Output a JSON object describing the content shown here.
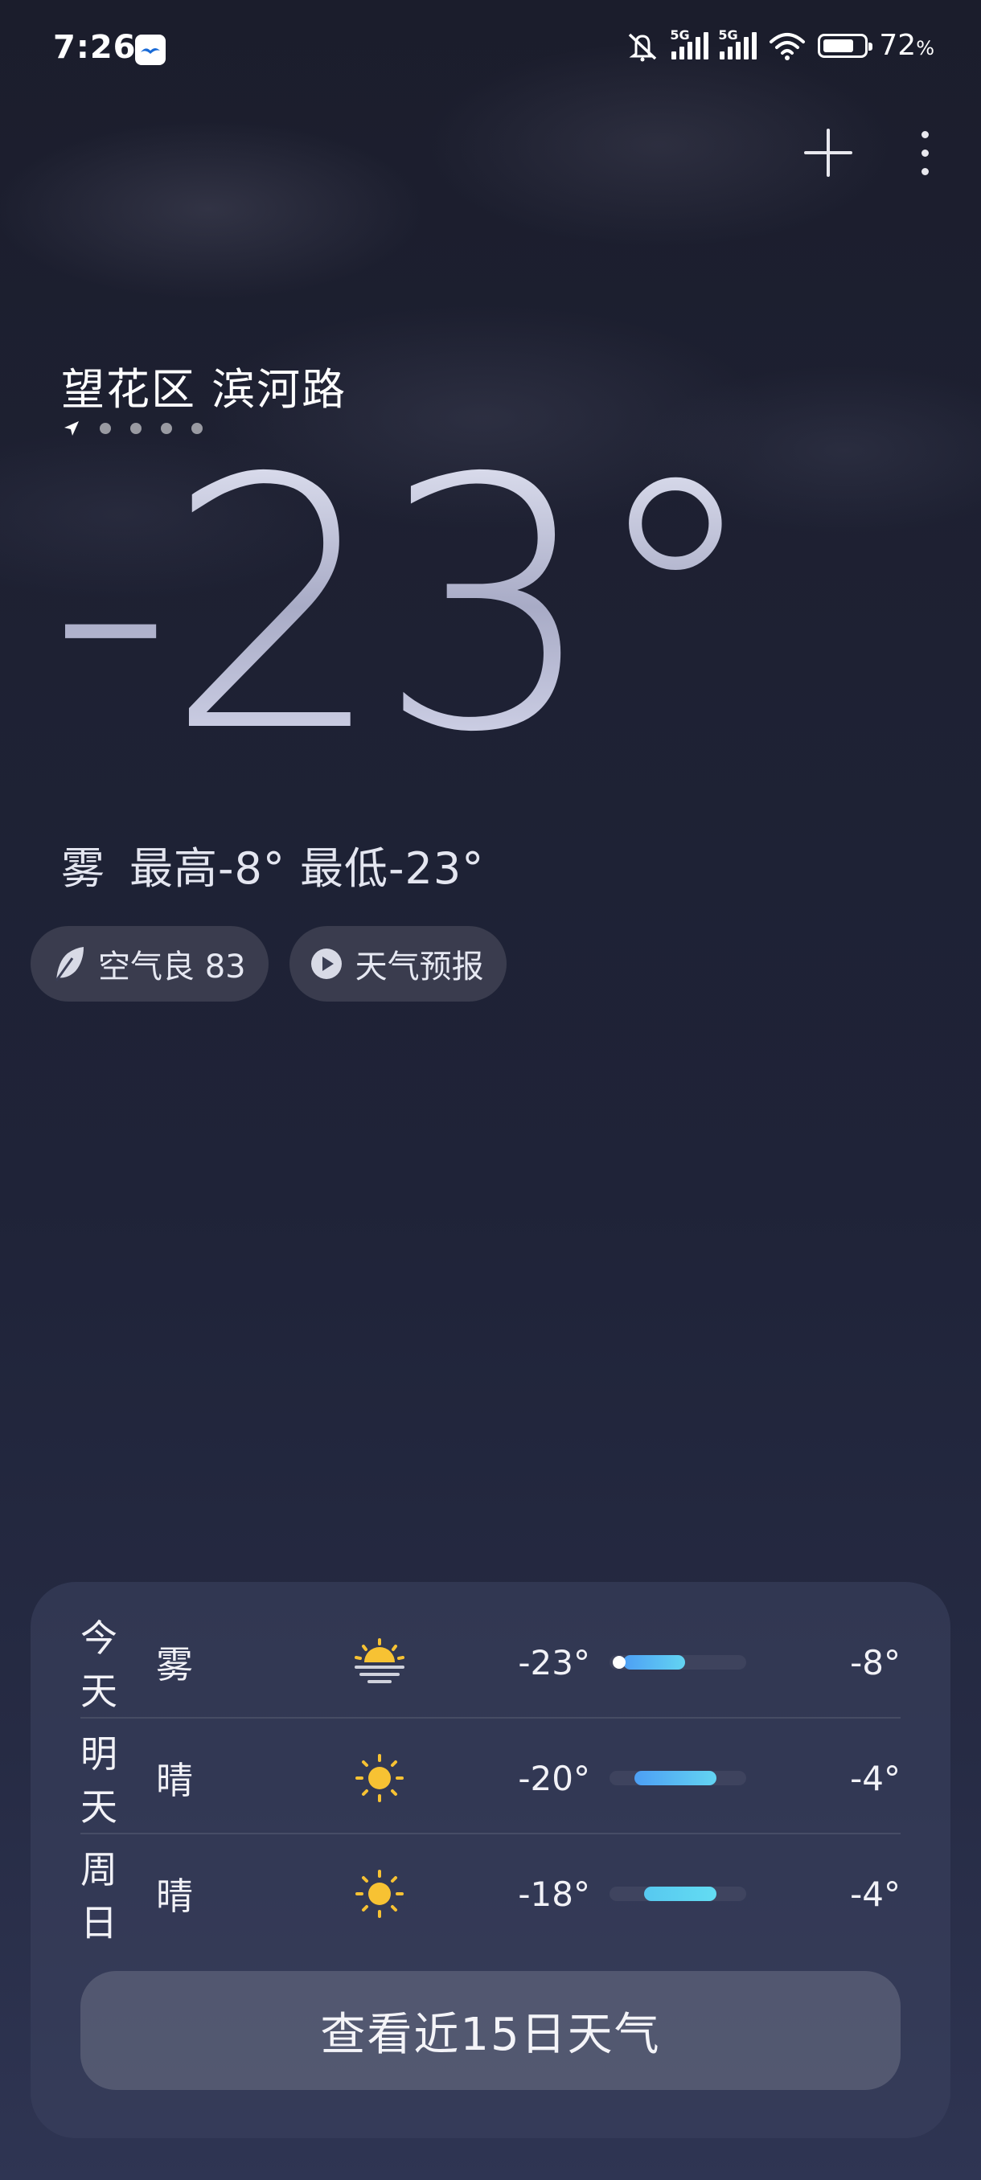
{
  "status_bar": {
    "time": "7:26",
    "network1": "5G",
    "network2": "5G",
    "battery_percent": "72",
    "battery_unit": "%"
  },
  "location": "望花区 滨河路",
  "current": {
    "temperature": "-23°",
    "condition": "雾",
    "high": "最高-8°",
    "low": "最低-23°"
  },
  "chips": {
    "air_quality": "空气良 83",
    "forecast": "天气预报"
  },
  "forecast": [
    {
      "day": "今天",
      "condition": "雾",
      "icon": "fog-sun-icon",
      "low": "-23°",
      "high": "-8°",
      "bar_start": 0.1,
      "bar_end": 0.55,
      "current_marker": 0.05
    },
    {
      "day": "明天",
      "condition": "晴",
      "icon": "sun-icon",
      "low": "-20°",
      "high": "-4°",
      "bar_start": 0.18,
      "bar_end": 0.78
    },
    {
      "day": "周日",
      "condition": "晴",
      "icon": "sun-icon",
      "low": "-18°",
      "high": "-4°",
      "bar_start": 0.25,
      "bar_end": 0.78
    }
  ],
  "more_button": "查看近15日天气",
  "colors": {
    "sun": "#f7c233",
    "bar_start": "#4d9ff4",
    "bar_end": "#63d4f2"
  }
}
